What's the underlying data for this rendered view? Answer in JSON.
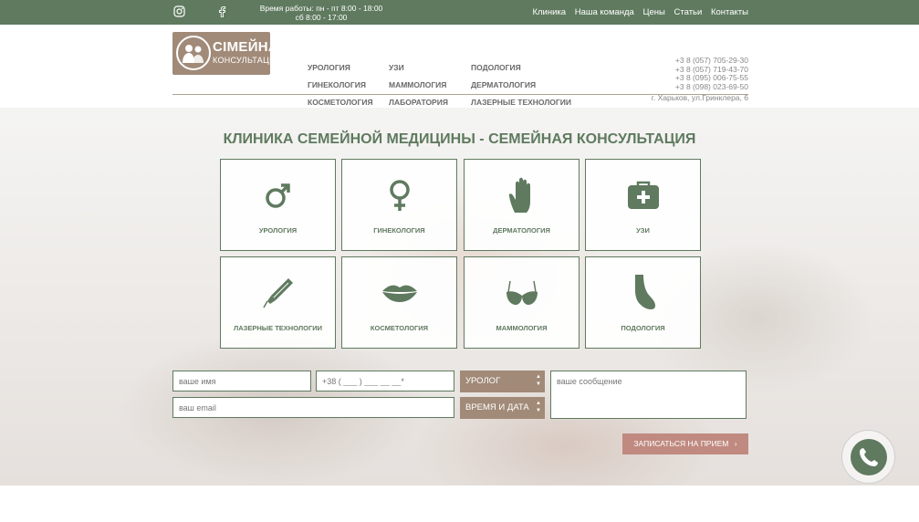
{
  "topbar": {
    "hours_line1": "Время работы: пн - пт 8:00 - 18:00",
    "hours_line2": "сб 8:00 - 17:00",
    "nav": [
      "Клиника",
      "Наша команда",
      "Цены",
      "Статьи",
      "Контакты"
    ],
    "social_icons": [
      "instagram-icon",
      "facebook-icon"
    ]
  },
  "logo": {
    "line1": "СІМЕЙНА",
    "line2": "КОНСУЛЬТАЦІЯ"
  },
  "menu": {
    "col1": [
      "УРОЛОГИЯ",
      "ГИНЕКОЛОГИЯ",
      "КОСМЕТОЛОГИЯ"
    ],
    "col2": [
      "УЗИ",
      "МАММОЛОГИЯ",
      "ЛАБОРАТОРИЯ"
    ],
    "col3": [
      "ПОДОЛОГИЯ",
      "ДЕРМАТОЛОГИЯ",
      "ЛАЗЕРНЫЕ ТЕХНОЛОГИИ"
    ]
  },
  "contacts": {
    "phones": [
      "+3 8 (057) 705-29-30",
      "+3 8 (057) 719-43-70",
      "+3 8 (095) 006-75-55",
      "+3 8 (098) 023-69-50"
    ],
    "address": "г. Харьков, ул.Гринклера, 6"
  },
  "hero": {
    "title": "КЛИНИКА СЕМЕЙНОЙ МЕДИЦИНЫ - СЕМЕЙНАЯ КОНСУЛЬТАЦИЯ",
    "tiles": [
      {
        "label": "УРОЛОГИЯ",
        "icon": "male-symbol-icon"
      },
      {
        "label": "ГИНЕКОЛОГИЯ",
        "icon": "female-symbol-icon"
      },
      {
        "label": "ДЕРМАТОЛОГИЯ",
        "icon": "hand-icon"
      },
      {
        "label": "УЗИ",
        "icon": "medical-kit-icon"
      },
      {
        "label": "ЛАЗЕРНЫЕ ТЕХНОЛОГИИ",
        "icon": "laser-pen-icon"
      },
      {
        "label": "КОСМЕТОЛОГИЯ",
        "icon": "lips-icon"
      },
      {
        "label": "МАММОЛОГИЯ",
        "icon": "bra-icon"
      },
      {
        "label": "ПОДОЛОГИЯ",
        "icon": "foot-icon"
      }
    ]
  },
  "form": {
    "name_placeholder": "ваше имя",
    "phone_placeholder": "+38 ( ___ ) ___ __ __*",
    "email_placeholder": "ваш email",
    "message_placeholder": "ваше сообщение",
    "doctor_selected": "УРОЛОГ",
    "datetime_selected": "ВРЕМЯ И ДАТА",
    "submit_label": "ЗАПИСАТЬСЯ НА ПРИЕМ"
  },
  "colors": {
    "brand_green": "#5f7a5f",
    "brand_brown": "#a18a78",
    "submit_pink": "#c08a80"
  }
}
